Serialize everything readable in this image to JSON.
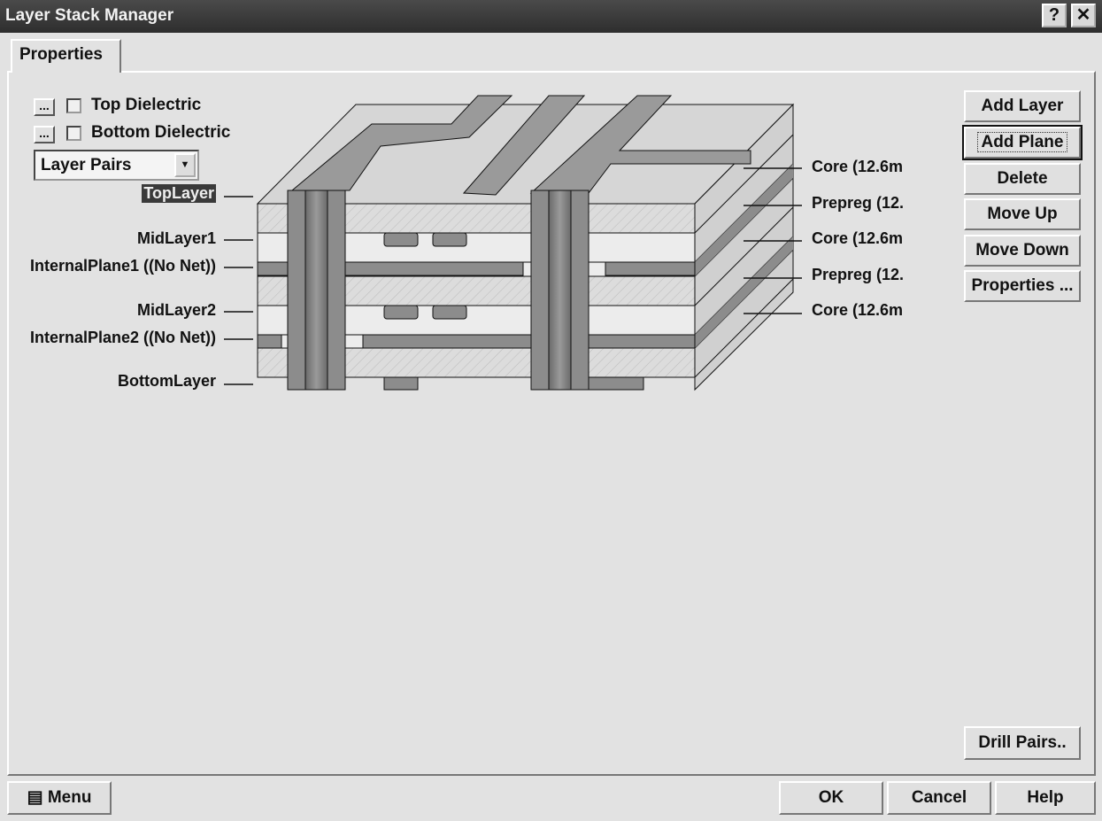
{
  "window": {
    "title": "Layer Stack Manager",
    "help_button": "?",
    "close_button": "✕"
  },
  "tabs": [
    {
      "label": "Properties",
      "active": true
    }
  ],
  "options": {
    "top_dielectric": {
      "label": "Top Dielectric",
      "checked": false,
      "edit_button": "..."
    },
    "bottom_dielectric": {
      "label": "Bottom Dielectric",
      "checked": false,
      "edit_button": "..."
    },
    "view_select": {
      "value": "Layer Pairs"
    }
  },
  "layers_left": [
    {
      "label": "TopLayer",
      "selected": true
    },
    {
      "label": "MidLayer1"
    },
    {
      "label": "InternalPlane1 ((No Net))"
    },
    {
      "label": "MidLayer2"
    },
    {
      "label": "InternalPlane2 ((No Net))"
    },
    {
      "label": "BottomLayer"
    }
  ],
  "dielectrics_right": [
    {
      "label": "Core (12.6m"
    },
    {
      "label": "Prepreg (12."
    },
    {
      "label": "Core (12.6m"
    },
    {
      "label": "Prepreg (12."
    },
    {
      "label": "Core (12.6m"
    }
  ],
  "side_buttons": [
    "Add Layer",
    "Add Plane",
    "Delete",
    "Move Up",
    "Move Down",
    "Properties ..."
  ],
  "drill_pairs": "Drill Pairs..",
  "footer": {
    "menu": "Menu",
    "ok": "OK",
    "cancel": "Cancel",
    "help": "Help"
  },
  "colors": {
    "titlebar": "#3a3a3a",
    "face": "#e2e2e2",
    "copper": "#8c8c8c",
    "selection": "#3a3a3a"
  }
}
